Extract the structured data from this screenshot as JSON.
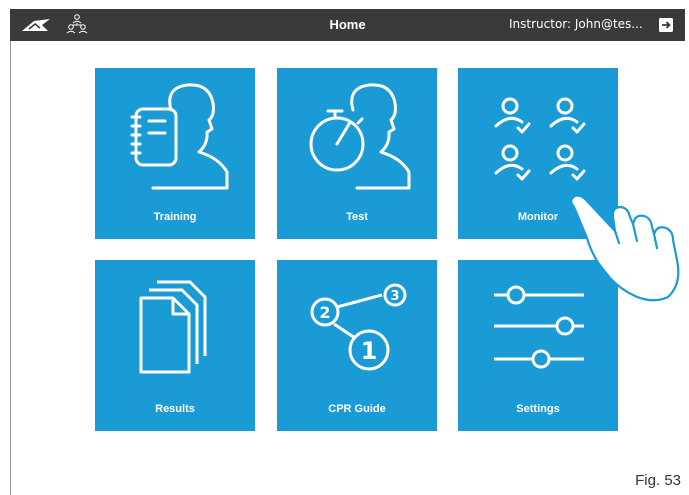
{
  "header": {
    "title": "Home",
    "user_label": "Instructor: John@tes...",
    "logo_icon": "3b-logo-icon",
    "users_icon": "user-group-icon",
    "logout_icon": "logout-icon",
    "bar_color": "#3a3a3a"
  },
  "tiles": [
    {
      "label": "Training",
      "icon": "training-icon"
    },
    {
      "label": "Test",
      "icon": "stopwatch-icon"
    },
    {
      "label": "Monitor",
      "icon": "monitor-users-icon"
    },
    {
      "label": "Results",
      "icon": "documents-icon"
    },
    {
      "label": "CPR Guide",
      "icon": "cpr-guide-icon"
    },
    {
      "label": "Settings",
      "icon": "sliders-icon"
    }
  ],
  "tile_color": "#1b9bd6",
  "cpr_guide_numbers": [
    "2",
    "3",
    "1"
  ],
  "pointer": "pointing-hand-icon",
  "figure_caption": "Fig. 53"
}
